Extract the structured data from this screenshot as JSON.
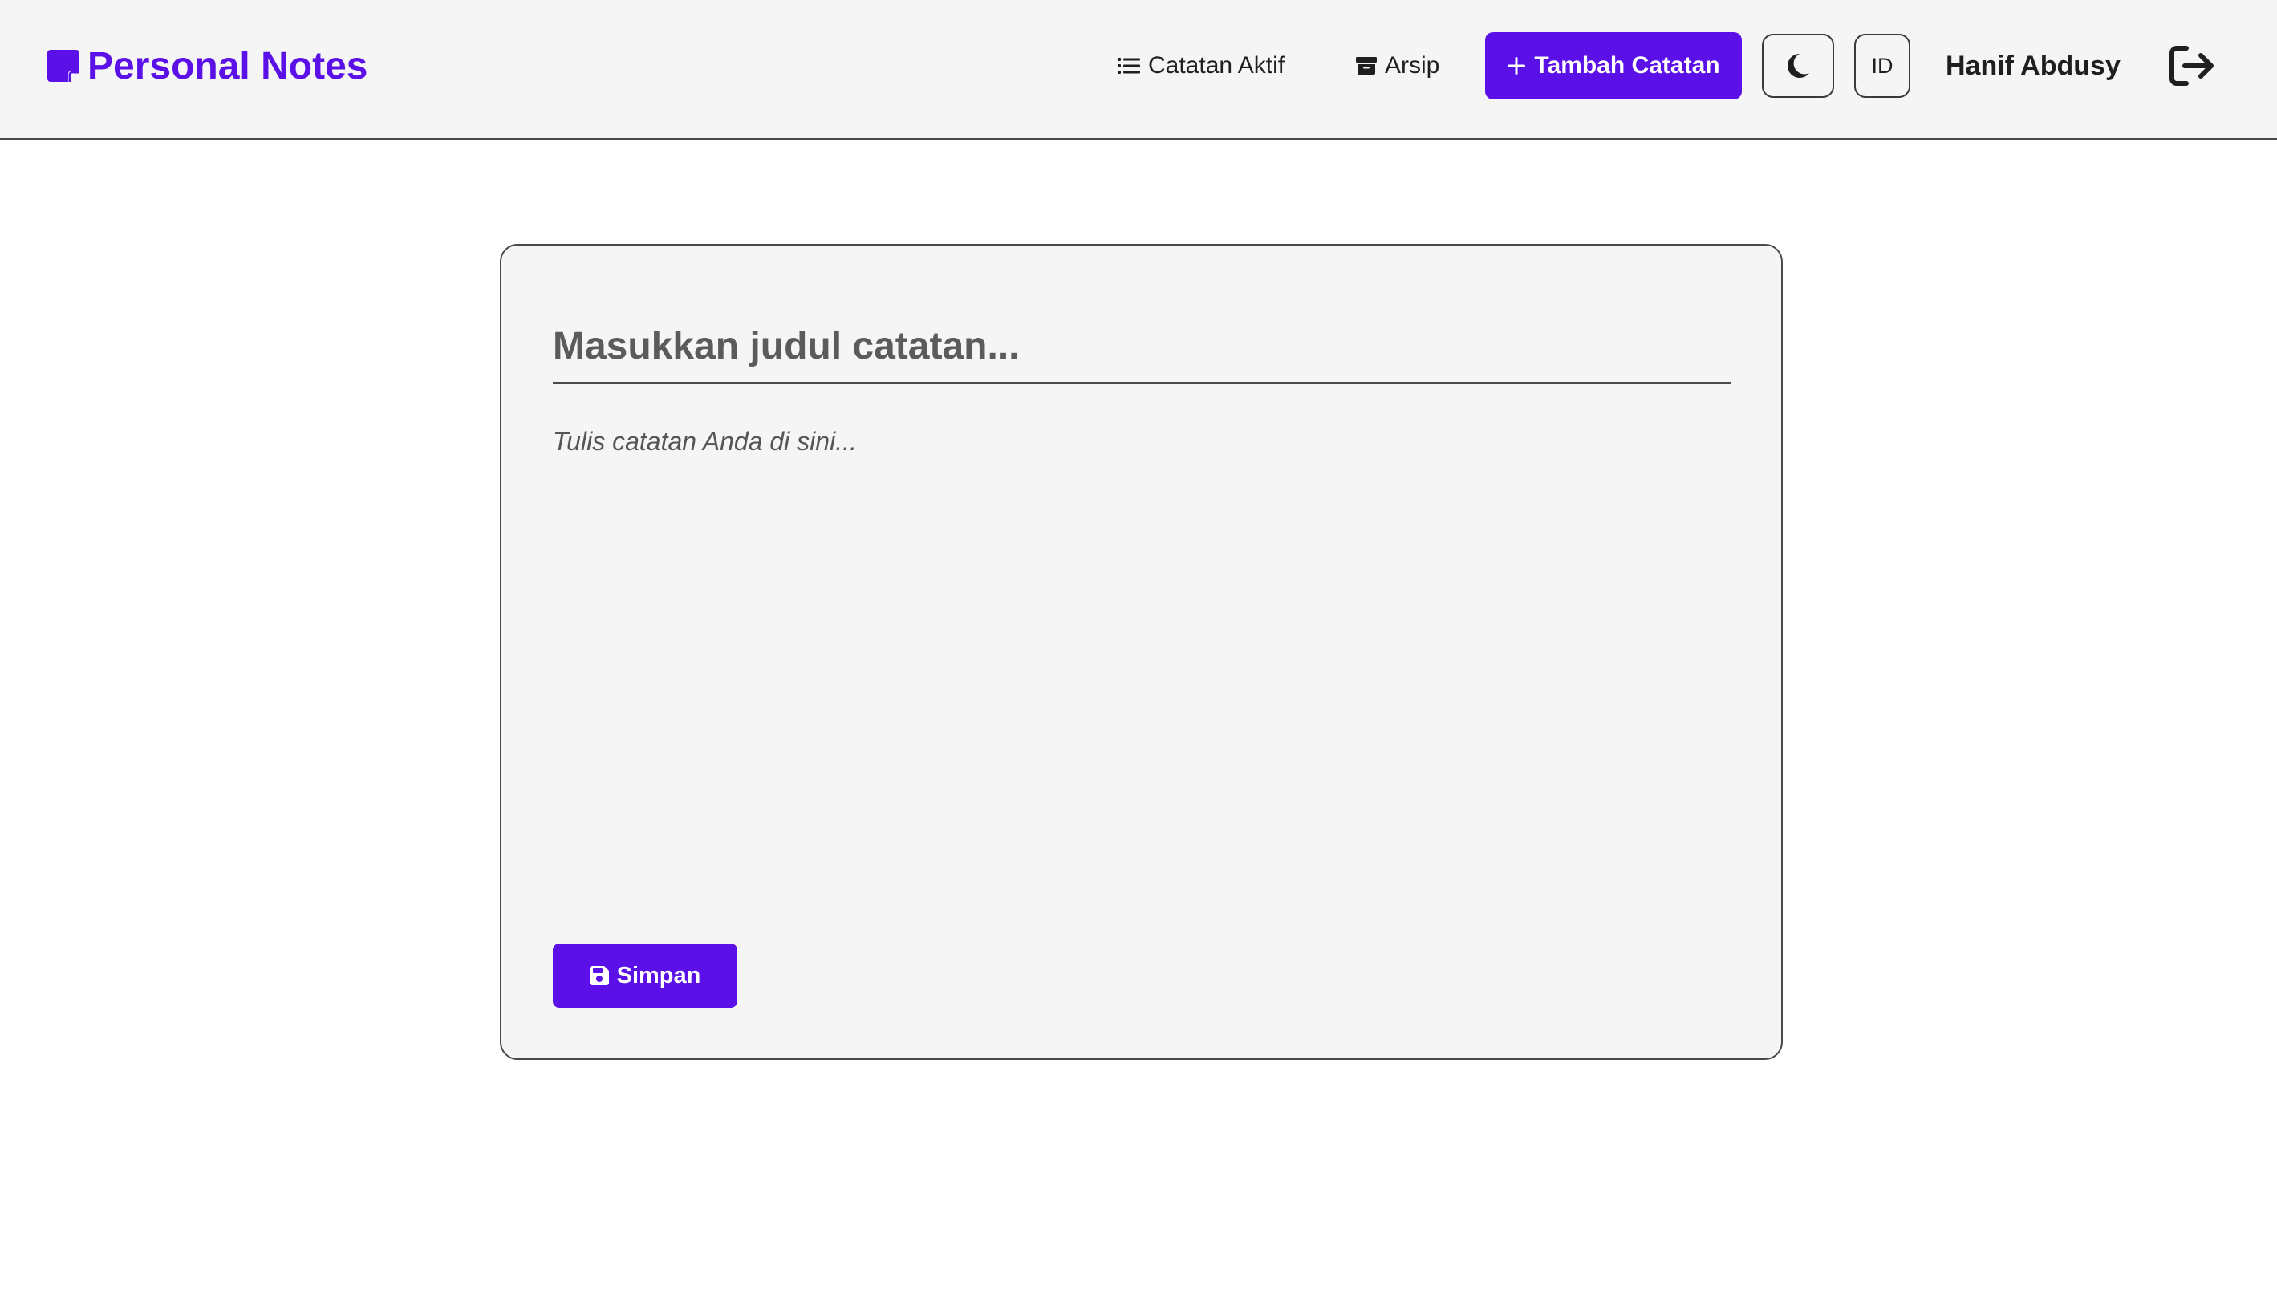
{
  "header": {
    "brand": {
      "title": "Personal Notes",
      "icon": "sticky-note-icon"
    },
    "nav": {
      "active_notes": {
        "label": "Catatan Aktif",
        "icon": "list-icon"
      },
      "archive": {
        "label": "Arsip",
        "icon": "archive-box-icon"
      }
    },
    "add_button": {
      "label": "Tambah Catatan",
      "icon": "plus-icon"
    },
    "theme_toggle": {
      "icon": "moon-icon"
    },
    "language_toggle": {
      "label": "ID"
    },
    "user": {
      "name": "Hanif Abdusy"
    },
    "logout": {
      "icon": "logout-icon"
    }
  },
  "editor": {
    "title_input": {
      "value": "",
      "placeholder": "Masukkan judul catatan..."
    },
    "body_input": {
      "value": "",
      "placeholder": "Tulis catatan Anda di sini..."
    },
    "save_button": {
      "label": "Simpan",
      "icon": "save-disk-icon"
    }
  },
  "colors": {
    "accent": "#5a10e6",
    "header_bg": "#f5f5f5",
    "card_bg": "#f5f5f5",
    "page_bg": "#ffffff",
    "text": "#1f1f1f"
  }
}
